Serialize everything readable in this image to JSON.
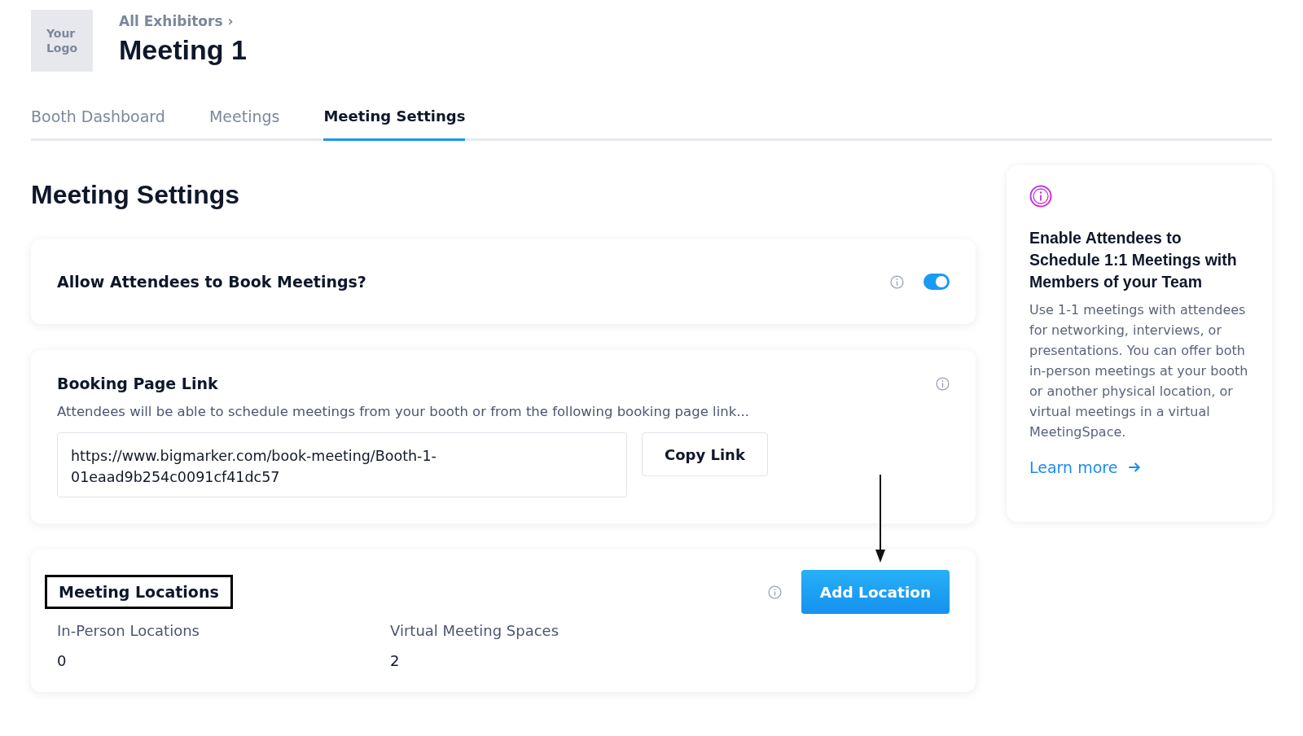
{
  "header": {
    "logo": [
      "Your",
      "Logo"
    ],
    "breadcrumb": "All Exhibitors ›",
    "title": "Meeting 1"
  },
  "tabs": [
    {
      "label": "Booth Dashboard",
      "selected": false
    },
    {
      "label": "Meetings",
      "selected": false
    },
    {
      "label": "Meeting Settings",
      "selected": true
    }
  ],
  "page_title": "Meeting Settings",
  "allow_booking": {
    "label": "Allow Attendees to Book Meetings?",
    "on": true
  },
  "booking_link": {
    "title": "Booking Page Link",
    "description": "Attendees will be able to schedule meetings from your booth or from the following booking page link...",
    "value": "https://www.bigmarker.com/book-meeting/Booth-1-01eaad9b254c0091cf41dc57",
    "button": "Copy Link"
  },
  "locations": {
    "title": "Meeting Locations",
    "button": "Add Location",
    "stats": [
      {
        "label": "In-Person Locations",
        "value": "0"
      },
      {
        "label": "Virtual Meeting Spaces",
        "value": "2"
      }
    ]
  },
  "info_card": {
    "title": "Enable Attendees to Schedule 1:1 Meetings with Members of your Team",
    "body": "Use 1-1 meetings with attendees for networking, interviews, or presentations. You can offer both in-person meetings at your booth or another physical location, or virtual meetings in a virtual MeetingSpace.",
    "link": "Learn more"
  }
}
